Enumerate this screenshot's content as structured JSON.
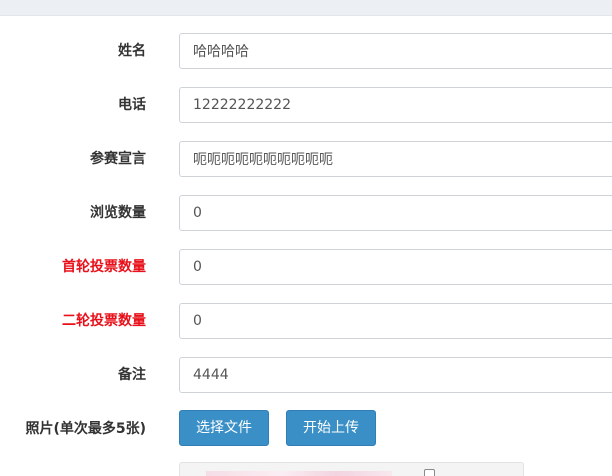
{
  "form": {
    "fields": [
      {
        "label": "姓名",
        "value": "哈哈哈哈",
        "highlight": false
      },
      {
        "label": "电话",
        "value": "12222222222",
        "highlight": false
      },
      {
        "label": "参赛宣言",
        "value": "呃呃呃呃呃呃呃呃呃呃",
        "highlight": false
      },
      {
        "label": "浏览数量",
        "value": "0",
        "highlight": false
      },
      {
        "label": "首轮投票数量",
        "value": "0",
        "highlight": true
      },
      {
        "label": "二轮投票数量",
        "value": "0",
        "highlight": true
      },
      {
        "label": "备注",
        "value": "4444",
        "highlight": false
      }
    ],
    "photo_label": "照片(单次最多5张)",
    "choose_file_label": "选择文件",
    "start_upload_label": "开始上传"
  },
  "colors": {
    "label_highlight": "#e8101a",
    "button_primary": "#3a8fc6",
    "top_bar": "#eceff3"
  }
}
